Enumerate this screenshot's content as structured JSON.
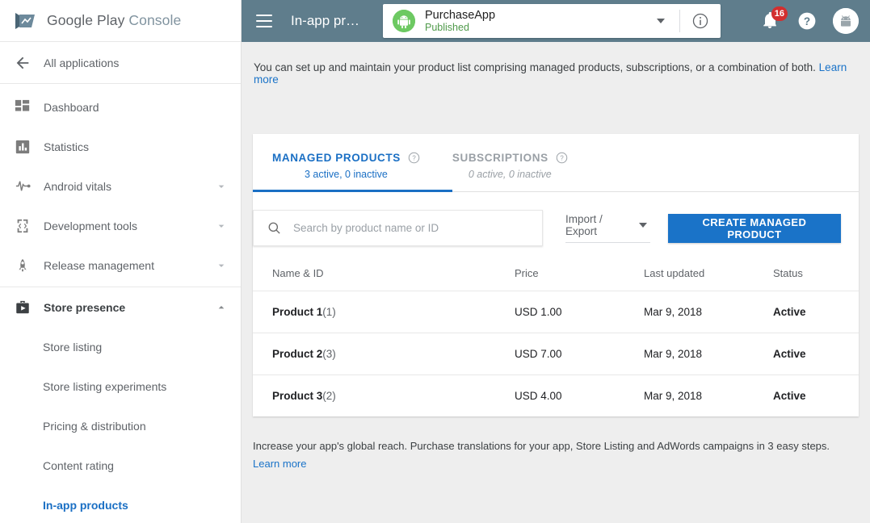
{
  "brand": {
    "name": "Google Play",
    "suffix": "Console"
  },
  "sidebar": {
    "all_applications": "All applications",
    "items": [
      {
        "label": "Dashboard",
        "icon": "dashboard-icon",
        "expandable": false
      },
      {
        "label": "Statistics",
        "icon": "statistics-icon",
        "expandable": false
      },
      {
        "label": "Android vitals",
        "icon": "pulse-icon",
        "expandable": true
      },
      {
        "label": "Development tools",
        "icon": "code-brackets-icon",
        "expandable": true
      },
      {
        "label": "Release management",
        "icon": "rocket-icon",
        "expandable": true
      },
      {
        "label": "Store presence",
        "icon": "store-bag-icon",
        "expandable": true,
        "expanded": true
      }
    ],
    "sub_items": [
      {
        "label": "Store listing",
        "active": false
      },
      {
        "label": "Store listing experiments",
        "active": false
      },
      {
        "label": "Pricing & distribution",
        "active": false
      },
      {
        "label": "Content rating",
        "active": false
      },
      {
        "label": "In-app products",
        "active": true
      }
    ]
  },
  "header": {
    "title": "In-app pr…",
    "app_name": "PurchaseApp",
    "app_status": "Published",
    "notification_count": "16",
    "bar_color": "#5f7d8c",
    "app_icon_color": "#6dc962"
  },
  "intro": {
    "text": "You can set up and maintain your product list comprising managed products, subscriptions, or a combination of both.",
    "link": "Learn more"
  },
  "tabs": [
    {
      "label": "MANAGED PRODUCTS",
      "sub": "3 active, 0 inactive",
      "active": true
    },
    {
      "label": "SUBSCRIPTIONS",
      "sub": "0 active, 0 inactive",
      "active": false
    }
  ],
  "toolbar": {
    "search_placeholder": "Search by product name or ID",
    "search_value": "",
    "import_export_label": "Import / Export",
    "create_label": "CREATE MANAGED PRODUCT",
    "accent_color": "#1a73c8"
  },
  "table": {
    "columns": [
      "Name & ID",
      "Price",
      "Last updated",
      "Status"
    ],
    "rows": [
      {
        "name": "Product 1",
        "id": "(1)",
        "price": "USD 1.00",
        "updated": "Mar 9, 2018",
        "status": "Active"
      },
      {
        "name": "Product 2",
        "id": "(3)",
        "price": "USD 7.00",
        "updated": "Mar 9, 2018",
        "status": "Active"
      },
      {
        "name": "Product 3",
        "id": "(2)",
        "price": "USD 4.00",
        "updated": "Mar 9, 2018",
        "status": "Active"
      }
    ]
  },
  "footer": {
    "text": "Increase your app's global reach. Purchase translations for your app, Store Listing and AdWords campaigns in 3 easy steps.",
    "link": "Learn more"
  }
}
